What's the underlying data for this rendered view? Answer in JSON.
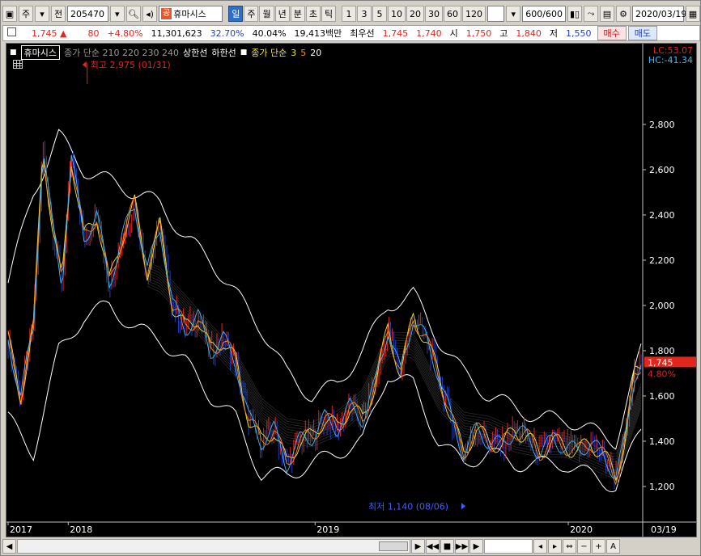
{
  "toolbar": {
    "period_button": "주",
    "prev_button": "전",
    "code": "205470",
    "gong_tag": "공",
    "stock_name": "휴마시스",
    "tabs": [
      "일",
      "주",
      "월",
      "년",
      "분",
      "초",
      "틱"
    ],
    "active_tab": "일",
    "periods": [
      "1",
      "3",
      "5",
      "10",
      "20",
      "30",
      "60",
      "120"
    ],
    "count": "600",
    "count_total": "/600",
    "date": "2020/03/19"
  },
  "quote": {
    "price": "1,745",
    "arrow": "▲",
    "change": "80",
    "change_pct": "+4.80%",
    "volume": "11,301,623",
    "vol_ratio": "32.70%",
    "turnover": "40.04%",
    "amount": "19,413백만",
    "best_ask_label": "최우선",
    "best_ask": "1,745",
    "best_bid": "1,740",
    "open_label": "시",
    "open": "1,750",
    "high_label": "고",
    "high": "1,840",
    "low_label": "저",
    "low": "1,550",
    "buy_button": "매수",
    "sell_button": "매도"
  },
  "legend": {
    "stock": "휴마시스",
    "ma_long": "종가 단순 210 220 230 240",
    "upper": "상한선",
    "lower": "하한선",
    "ma_short_label": "종가 단순",
    "ma_short": [
      "3",
      "5",
      "20"
    ],
    "lc": "LC:53.07",
    "hc": "HC:-41.34"
  },
  "annotations": {
    "high": "최고 2,975 (01/31)",
    "low": "최저 1,140 (08/06)"
  },
  "price_tag": {
    "price": "1,745",
    "pct": "4.80%"
  },
  "colors": {
    "up": "#e1261c",
    "down": "#1f3fbf",
    "price_tag": "#e1261c",
    "ma3": "#f2e338",
    "ma5": "#ff8a1a",
    "ma20": "#3fb8ff",
    "envelope": "#ffffff"
  },
  "bottom": {
    "buttons": [
      "◀",
      "◀◀",
      "■",
      "▶▶",
      "▶",
      "−",
      "+",
      "A"
    ]
  },
  "chart_data": {
    "type": "line",
    "title": "",
    "xlabel": "",
    "ylabel": "",
    "ylim": [
      1050,
      3050
    ],
    "yticks": [
      "2,800",
      "2,600",
      "2,400",
      "2,200",
      "2,000",
      "1,800",
      "1,600",
      "1,400",
      "1,200"
    ],
    "ytick_values": [
      2800,
      2600,
      2400,
      2200,
      2000,
      1800,
      1600,
      1400,
      1200
    ],
    "x_labels": [
      "2017",
      "2018",
      "2019",
      "2020",
      "03/19"
    ],
    "x_label_t": [
      0,
      0.095,
      0.485,
      0.885,
      1.0
    ],
    "series": [
      {
        "name": "",
        "t": [
          0,
          0.02,
          0.04,
          0.055,
          0.07,
          0.085,
          0.1,
          0.12,
          0.14,
          0.16,
          0.18,
          0.2,
          0.22,
          0.24,
          0.26,
          0.28,
          0.3,
          0.32,
          0.34,
          0.36,
          0.38,
          0.4,
          0.42,
          0.44,
          0.46,
          0.48,
          0.5,
          0.52,
          0.54,
          0.56,
          0.58,
          0.6,
          0.62,
          0.64,
          0.66,
          0.68,
          0.7,
          0.72,
          0.74,
          0.76,
          0.78,
          0.8,
          0.82,
          0.84,
          0.86,
          0.88,
          0.9,
          0.92,
          0.935,
          0.95,
          0.96,
          0.975,
          0.99,
          1.0
        ],
        "values": [
          1850,
          1600,
          1900,
          2700,
          2350,
          2100,
          2650,
          2300,
          2400,
          2100,
          2300,
          2450,
          2150,
          2350,
          2000,
          1900,
          1950,
          1800,
          1850,
          1750,
          1500,
          1400,
          1450,
          1300,
          1400,
          1420,
          1500,
          1460,
          1550,
          1500,
          1650,
          1900,
          1700,
          1950,
          1850,
          1700,
          1500,
          1350,
          1450,
          1400,
          1380,
          1450,
          1420,
          1350,
          1400,
          1380,
          1350,
          1400,
          1350,
          1300,
          1250,
          1400,
          1700,
          1745
        ]
      },
      {
        "name": "",
        "t": [
          0,
          0.04,
          0.08,
          0.12,
          0.16,
          0.2,
          0.24,
          0.28,
          0.32,
          0.36,
          0.4,
          0.44,
          0.48,
          0.52,
          0.56,
          0.6,
          0.64,
          0.68,
          0.72,
          0.76,
          0.8,
          0.84,
          0.88,
          0.92,
          0.96,
          1.0
        ],
        "values": [
          2100,
          2500,
          2750,
          2600,
          2550,
          2500,
          2450,
          2300,
          2200,
          2050,
          1900,
          1700,
          1600,
          1650,
          1800,
          2000,
          2050,
          1850,
          1700,
          1600,
          1550,
          1500,
          1500,
          1450,
          1400,
          1800
        ]
      },
      {
        "name": "",
        "t": [
          0,
          0.04,
          0.08,
          0.12,
          0.16,
          0.2,
          0.24,
          0.28,
          0.32,
          0.36,
          0.4,
          0.44,
          0.48,
          0.52,
          0.56,
          0.6,
          0.64,
          0.68,
          0.72,
          0.76,
          0.8,
          0.84,
          0.88,
          0.92,
          0.96,
          1.0
        ],
        "values": [
          1500,
          1350,
          1800,
          1950,
          2000,
          1900,
          1850,
          1750,
          1600,
          1500,
          1250,
          1250,
          1300,
          1350,
          1400,
          1700,
          1650,
          1400,
          1300,
          1350,
          1300,
          1300,
          1300,
          1250,
          1200,
          1450
        ]
      }
    ],
    "volume_ref_line": 1200,
    "grid": false,
    "legend_position": "top-left"
  }
}
